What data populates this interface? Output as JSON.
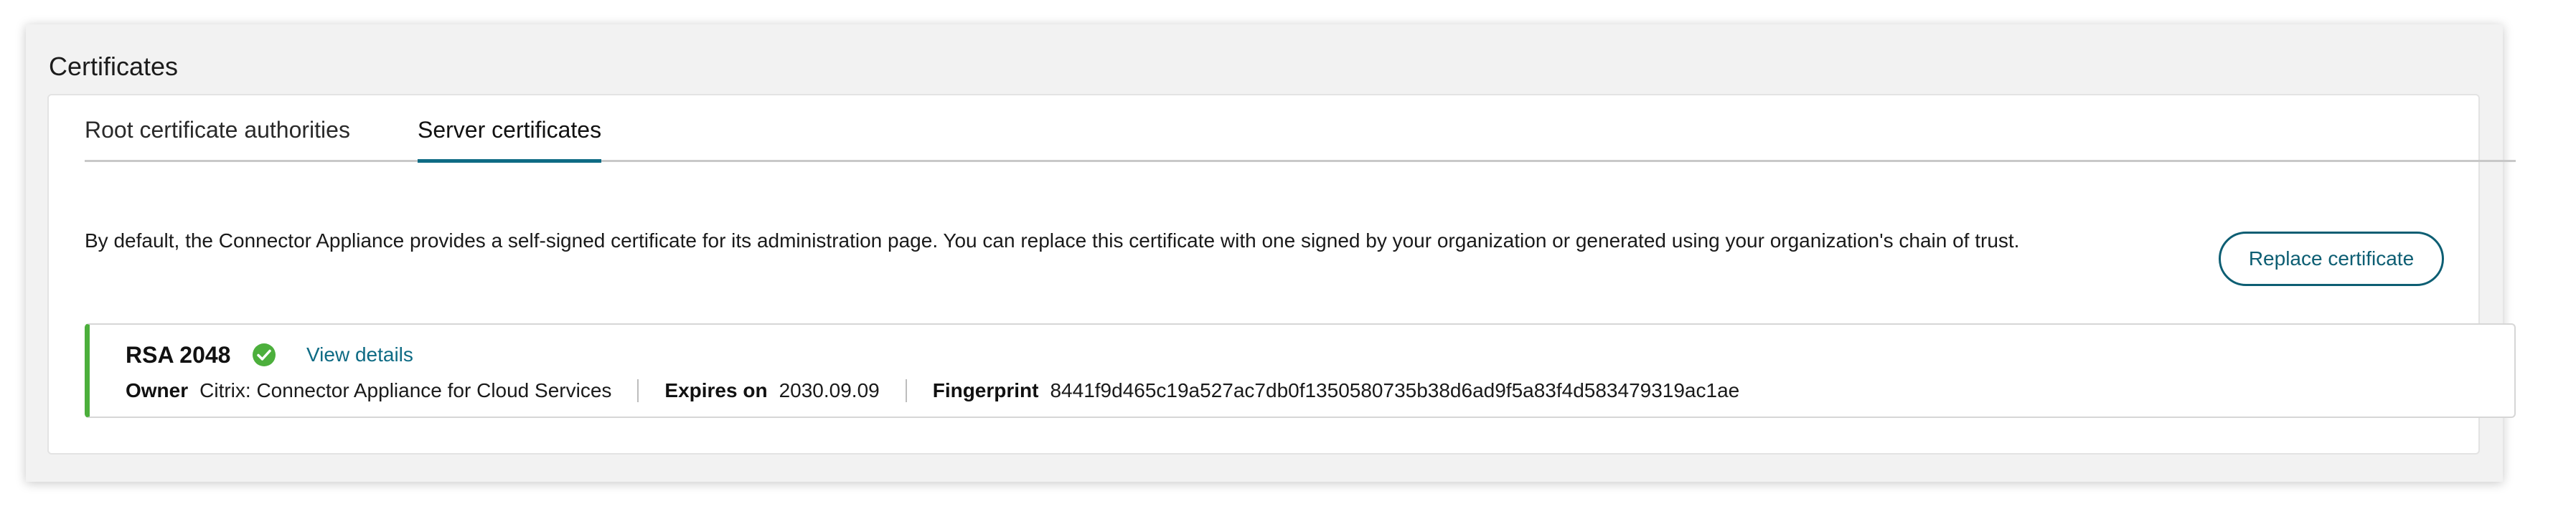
{
  "section": {
    "title": "Certificates"
  },
  "tabs": [
    {
      "label": "Root certificate authorities",
      "active": false
    },
    {
      "label": "Server certificates",
      "active": true
    }
  ],
  "description": "By default, the Connector Appliance provides a self-signed certificate for its administration page. You can replace this certificate with one signed by your organization or generated using your organization's chain of trust.",
  "actions": {
    "replace_label": "Replace certificate"
  },
  "certificate": {
    "name": "RSA 2048",
    "status_icon": "check-circle-icon",
    "view_details_label": "View details",
    "owner_label": "Owner",
    "owner_value": "Citrix: Connector Appliance for Cloud Services",
    "expires_label": "Expires on",
    "expires_value": "2030.09.09",
    "fingerprint_label": "Fingerprint",
    "fingerprint_value": "8441f9d465c19a527ac7db0f1350580735b38d6ad9f5a83f4d583479319ac1ae"
  },
  "colors": {
    "accent": "#0e6b84",
    "status_ok": "#4caf3c",
    "panel_bg": "#f2f2f2"
  }
}
